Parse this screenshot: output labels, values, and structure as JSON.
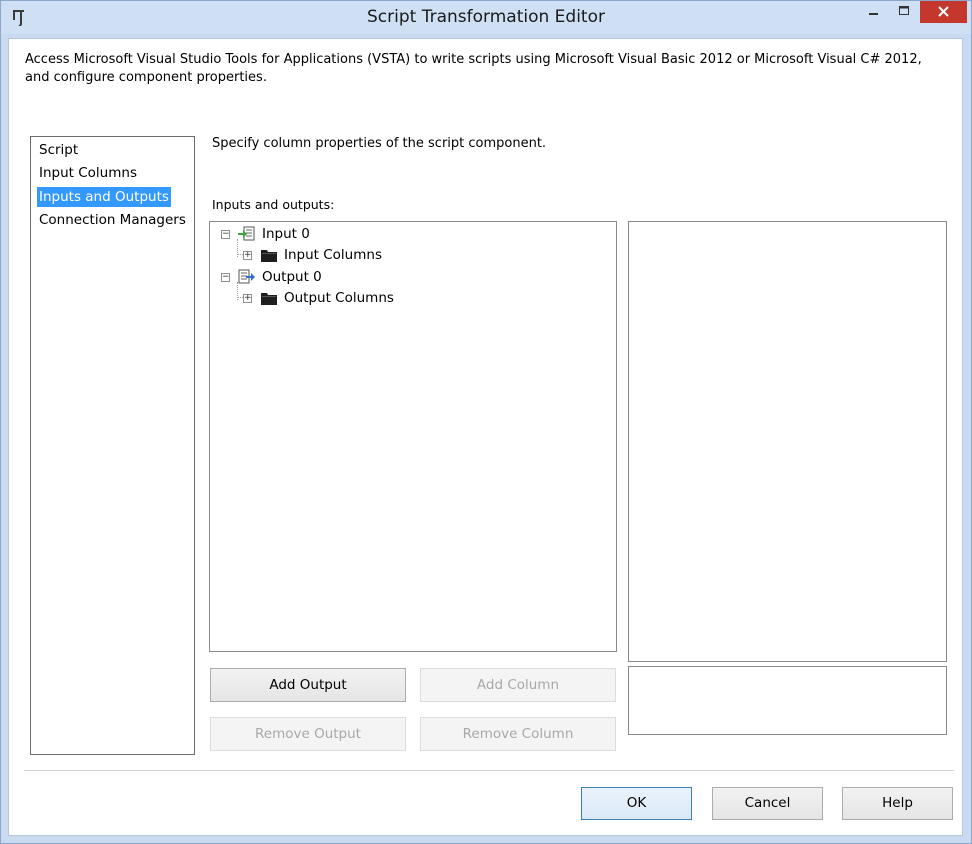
{
  "window": {
    "title": "Script Transformation Editor",
    "accent": "#3399ff",
    "close_color": "#c4372c"
  },
  "description": "Access Microsoft Visual Studio Tools for Applications (VSTA) to write scripts using Microsoft Visual Basic 2012 or Microsoft Visual C# 2012, and configure component properties.",
  "nav": {
    "items": [
      {
        "label": "Script",
        "selected": false
      },
      {
        "label": "Input Columns",
        "selected": false
      },
      {
        "label": "Inputs and Outputs",
        "selected": true
      },
      {
        "label": "Connection Managers",
        "selected": false
      }
    ]
  },
  "main": {
    "section_description": "Specify column properties of the script component.",
    "tree_label": "Inputs and outputs:",
    "tree": {
      "input": {
        "label": "Input 0",
        "icon": "input-icon",
        "child": {
          "label": "Input Columns",
          "icon": "folder-icon"
        }
      },
      "output": {
        "label": "Output 0",
        "icon": "output-icon",
        "child": {
          "label": "Output Columns",
          "icon": "folder-icon"
        }
      }
    }
  },
  "buttons": {
    "add_output": "Add Output",
    "add_column": "Add Column",
    "remove_output": "Remove Output",
    "remove_column": "Remove Column"
  },
  "footer": {
    "ok": "OK",
    "cancel": "Cancel",
    "help": "Help"
  }
}
